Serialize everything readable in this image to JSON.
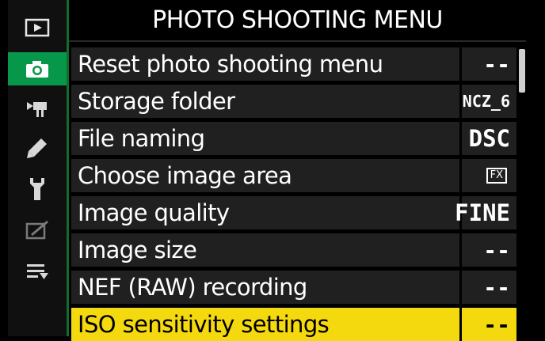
{
  "header": {
    "title": "PHOTO SHOOTING MENU"
  },
  "sidebar": {
    "icons": [
      {
        "name": "playback-icon",
        "active": false
      },
      {
        "name": "camera-icon",
        "active": true
      },
      {
        "name": "movie-icon",
        "active": false
      },
      {
        "name": "pencil-icon",
        "active": false
      },
      {
        "name": "wrench-icon",
        "active": false
      },
      {
        "name": "retouch-icon",
        "active": false
      },
      {
        "name": "my-menu-icon",
        "active": false
      }
    ]
  },
  "menu": {
    "items": [
      {
        "label": "Reset photo shooting menu",
        "value": "--"
      },
      {
        "label": "Storage folder",
        "value": "NCZ_6"
      },
      {
        "label": "File naming",
        "value": "DSC"
      },
      {
        "label": "Choose image area",
        "value": "FX"
      },
      {
        "label": "Image quality",
        "value": "FINE"
      },
      {
        "label": "Image size",
        "value": "--"
      },
      {
        "label": "NEF (RAW) recording",
        "value": "--"
      },
      {
        "label": "ISO sensitivity settings",
        "value": "--"
      }
    ],
    "selected_index": 7
  },
  "colors": {
    "active_tab": "#07974a",
    "selected_row": "#f5d90f",
    "row_background": "#202020"
  }
}
